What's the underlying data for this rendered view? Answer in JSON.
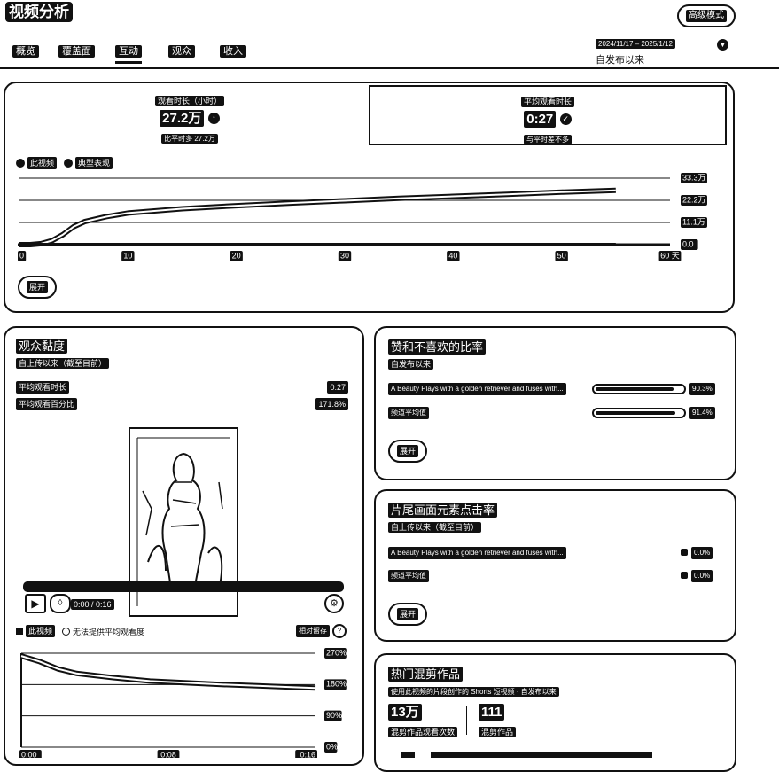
{
  "header": {
    "title": "视频分析",
    "advanced_mode": "高级模式",
    "date_range": "2024/11/17 – 2025/1/12",
    "date_label": "自发布以来"
  },
  "tabs": [
    {
      "label": "概览"
    },
    {
      "label": "覆盖面"
    },
    {
      "label": "互动",
      "active": true
    },
    {
      "label": "观众"
    },
    {
      "label": "收入"
    }
  ],
  "metrics": {
    "watch_time": {
      "label": "观看时长（小时）",
      "value": "27.2万",
      "compare": "比平时多 27.2万"
    },
    "avg_duration": {
      "label": "平均观看时长",
      "value": "0:27",
      "compare": "与平时差不多"
    }
  },
  "main_chart": {
    "legend": [
      "此视频",
      "典型表现"
    ],
    "expand_label": "展开"
  },
  "chart_data": {
    "type": "line",
    "x": [
      0,
      1,
      2,
      3,
      4,
      5,
      6,
      8,
      10,
      15,
      20,
      25,
      30,
      35,
      40,
      45,
      50,
      55
    ],
    "x_ticks": [
      "0",
      "10",
      "20",
      "30",
      "40",
      "50",
      "60 天"
    ],
    "y_ticks": [
      "0.0",
      "11.1万",
      "22.2万",
      "33.3万"
    ],
    "xlim": [
      0,
      60
    ],
    "ylim": [
      0,
      33.3
    ],
    "series": [
      {
        "name": "此视频",
        "values": [
          0,
          0,
          0.5,
          2.0,
          5.0,
          9.0,
          11.5,
          14.0,
          15.8,
          18.0,
          19.5,
          20.8,
          22.0,
          23.2,
          24.2,
          25.2,
          26.3,
          27.2
        ]
      },
      {
        "name": "典型表现",
        "values": [
          0,
          0,
          0,
          0,
          0,
          0,
          0,
          0,
          0,
          0,
          0,
          0,
          0,
          0,
          0,
          0,
          0,
          0
        ]
      }
    ],
    "retention": {
      "x_ticks": [
        "0:00",
        "0:08",
        "0:16"
      ],
      "y_ticks": [
        "270%",
        "180%",
        "90%",
        "0%"
      ],
      "ylim": [
        0,
        270
      ],
      "x": [
        0,
        1,
        2,
        3,
        5,
        7,
        9,
        11,
        13,
        15,
        16
      ],
      "values": [
        262,
        246,
        225,
        212,
        200,
        190,
        185,
        180,
        176,
        172,
        170
      ]
    }
  },
  "retention_card": {
    "title": "观众黏度",
    "subtitle": "自上传以来（截至目前）",
    "rows": [
      {
        "label": "平均观看时长",
        "value": "0:27"
      },
      {
        "label": "平均观看百分比",
        "value": "171.8%"
      }
    ],
    "player_time": "0:00 / 0:16",
    "legend_this": "此视频",
    "legend_typical": "无法提供平均观看度",
    "relative_label": "相对留存"
  },
  "likes_card": {
    "title": "赞和不喜欢的比率",
    "subtitle": "自发布以来",
    "rows": [
      {
        "label": "A Beauty Plays with a golden retriever and fuses with...",
        "value": "90.3%",
        "ratio": 0.903
      },
      {
        "label": "频道平均值",
        "value": "91.4%",
        "ratio": 0.914
      }
    ],
    "expand_label": "展开"
  },
  "endscreen_card": {
    "title": "片尾画面元素点击率",
    "subtitle": "自上传以来（截至目前）",
    "rows": [
      {
        "label": "A Beauty Plays with a golden retriever and fuses with...",
        "value": "0.0%"
      },
      {
        "label": "频道平均值",
        "value": "0.0%"
      }
    ],
    "expand_label": "展开"
  },
  "remix_card": {
    "title": "热门混剪作品",
    "subtitle": "使用此视频的片段创作的 Shorts 短视频 · 自发布以来",
    "stat1_value": "13万",
    "stat1_label": "混剪作品观看次数",
    "stat2_value": "111",
    "stat2_label": "混剪作品"
  },
  "colors": {
    "ink": "#111111",
    "paper": "#ffffff"
  }
}
